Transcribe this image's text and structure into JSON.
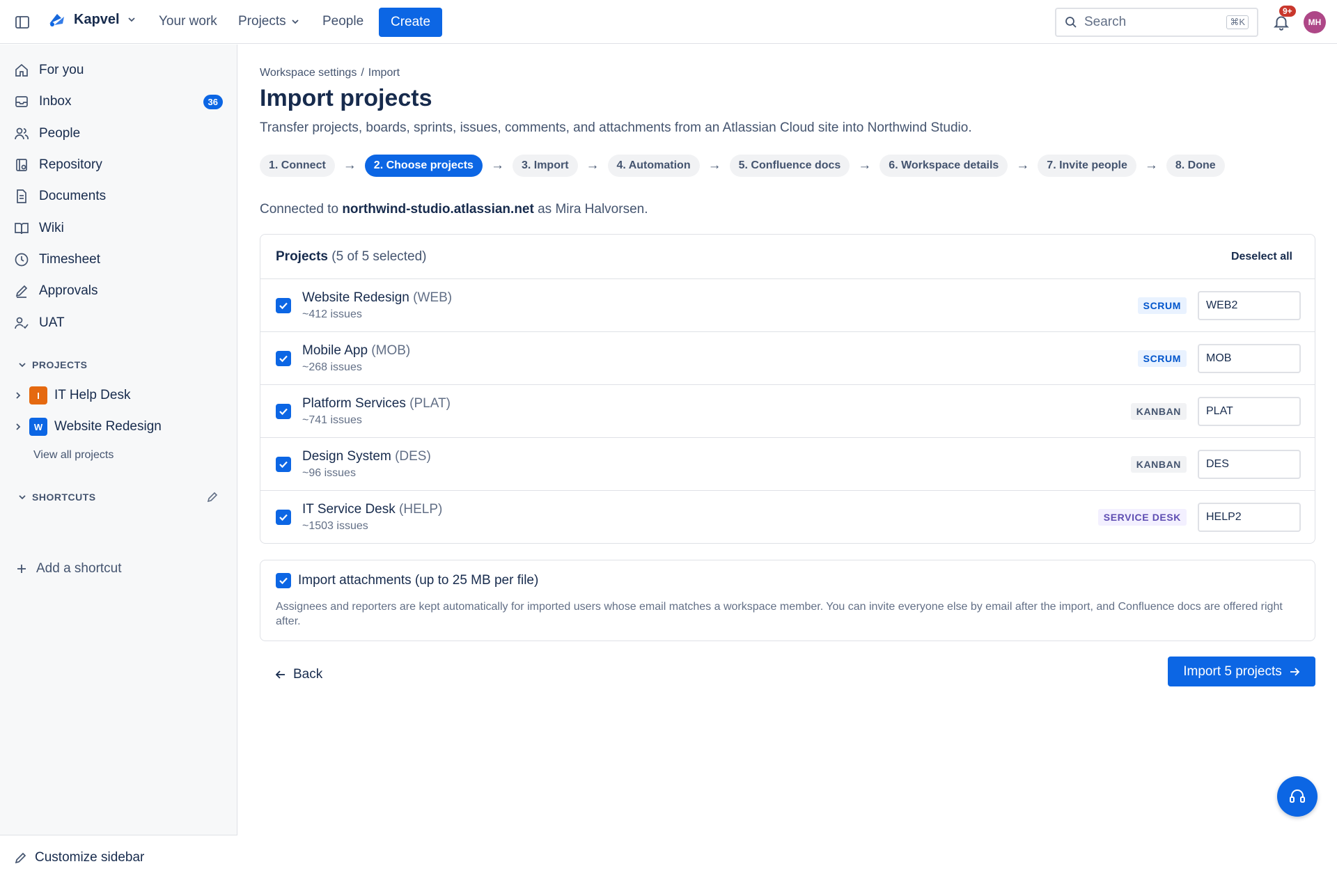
{
  "app": {
    "name": "Kapvel"
  },
  "topnav": {
    "your_work": "Your work",
    "projects": "Projects",
    "people": "People",
    "create": "Create",
    "search_placeholder": "Search",
    "search_shortcut": "⌘K",
    "notifications_badge": "9+",
    "avatar_initials": "MH"
  },
  "sidebar": {
    "items": [
      {
        "label": "For you",
        "icon": "home-icon"
      },
      {
        "label": "Inbox",
        "icon": "inbox-icon",
        "count": "36"
      },
      {
        "label": "People",
        "icon": "people-icon"
      },
      {
        "label": "Repository",
        "icon": "repository-icon"
      },
      {
        "label": "Documents",
        "icon": "document-icon"
      },
      {
        "label": "Wiki",
        "icon": "book-icon"
      },
      {
        "label": "Timesheet",
        "icon": "clock-icon"
      },
      {
        "label": "Approvals",
        "icon": "pen-icon"
      },
      {
        "label": "UAT",
        "icon": "user-check-icon"
      }
    ],
    "projects_heading": "PROJECTS",
    "projects": [
      {
        "initial": "I",
        "label": "IT Help Desk",
        "color": "#e56910"
      },
      {
        "initial": "W",
        "label": "Website Redesign",
        "color": "#0c66e4"
      }
    ],
    "view_all_projects": "View all projects",
    "shortcuts_heading": "SHORTCUTS",
    "add_shortcut": "Add a shortcut",
    "customize": "Customize sidebar"
  },
  "main": {
    "breadcrumb": [
      "Workspace settings",
      "Import"
    ],
    "breadcrumb_sep": "/",
    "title": "Import projects",
    "description": "Transfer projects, boards, sprints, issues, comments, and attachments from an Atlassian Cloud site into Northwind Studio.",
    "steps": [
      {
        "label": "1. Connect",
        "active": false
      },
      {
        "label": "2. Choose projects",
        "active": true
      },
      {
        "label": "3. Import",
        "active": false
      },
      {
        "label": "4. Automation",
        "active": false
      },
      {
        "label": "5. Confluence docs",
        "active": false
      },
      {
        "label": "6. Workspace details",
        "active": false
      },
      {
        "label": "7. Invite people",
        "active": false
      },
      {
        "label": "8. Done",
        "active": false
      }
    ],
    "connected_prefix": "Connected to",
    "connected_site": "northwind-studio.atlassian.net",
    "connected_suffix": "as Mira Halvorsen.",
    "projects_card": {
      "title": "Projects",
      "selected_text": "(5 of 5 selected)",
      "deselect_all": "Deselect all",
      "rows": [
        {
          "name": "Website Redesign",
          "key": "(WEB)",
          "issues": "~412 issues",
          "type": "SCRUM",
          "type_class": "scrum",
          "new_key": "WEB2",
          "checked": true
        },
        {
          "name": "Mobile App",
          "key": "(MOB)",
          "issues": "~268 issues",
          "type": "SCRUM",
          "type_class": "scrum",
          "new_key": "MOB",
          "checked": true
        },
        {
          "name": "Platform Services",
          "key": "(PLAT)",
          "issues": "~741 issues",
          "type": "KANBAN",
          "type_class": "kanban",
          "new_key": "PLAT",
          "checked": true
        },
        {
          "name": "Design System",
          "key": "(DES)",
          "issues": "~96 issues",
          "type": "KANBAN",
          "type_class": "kanban",
          "new_key": "DES",
          "checked": true
        },
        {
          "name": "IT Service Desk",
          "key": "(HELP)",
          "issues": "~1503 issues",
          "type": "SERVICE DESK",
          "type_class": "sd",
          "new_key": "HELP2",
          "checked": true
        }
      ]
    },
    "attachments": {
      "label": "Import attachments (up to 25 MB per file)",
      "checked": true,
      "note": "Assignees and reporters are kept automatically for imported users whose email matches a workspace member. You can invite everyone else by email after the import, and Confluence docs are offered right after."
    },
    "back": "Back",
    "import_button": "Import 5 projects"
  },
  "colors": {
    "primary": "#0c66e4",
    "danger": "#c9372c"
  }
}
